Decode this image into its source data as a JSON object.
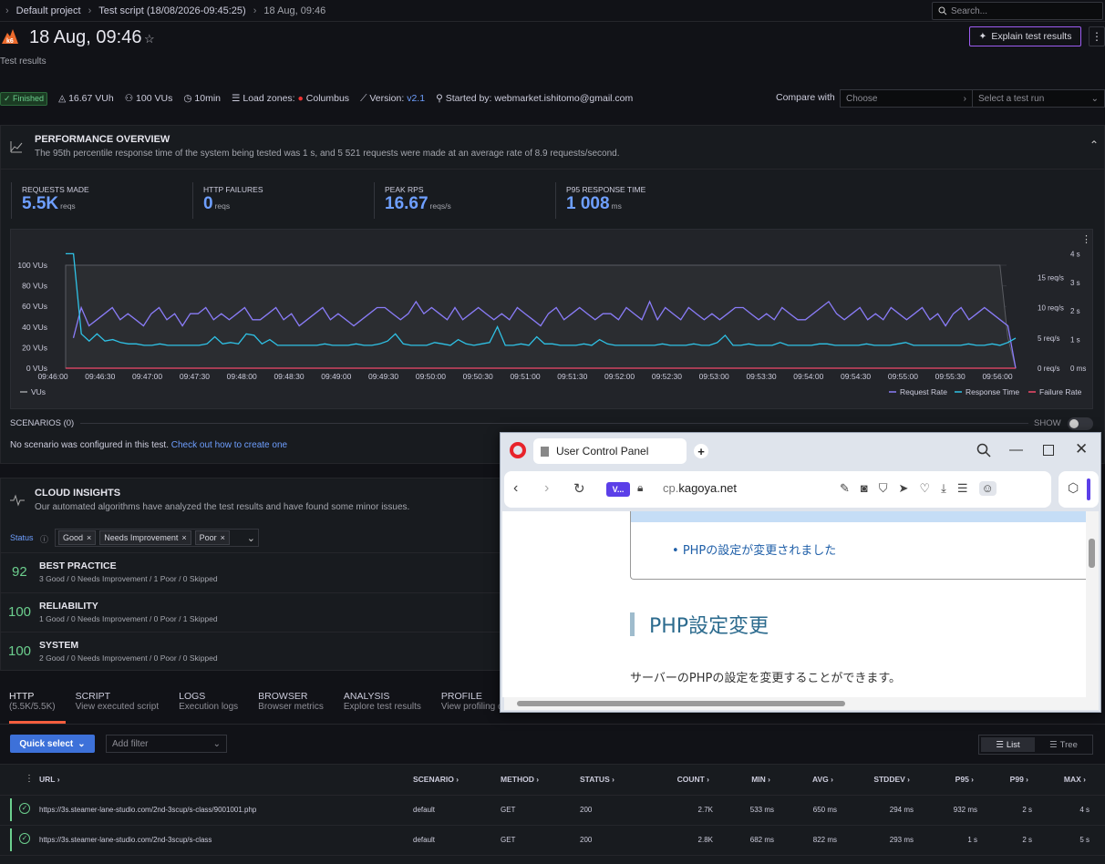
{
  "breadcrumb": {
    "project": "Default project",
    "script": "Test script (18/08/2026-09:45:25)",
    "run": "18 Aug, 09:46"
  },
  "search": {
    "placeholder": "Search..."
  },
  "header": {
    "title": "18 Aug, 09:46",
    "subtitle": "Test results",
    "explain": "Explain test results"
  },
  "meta": {
    "status": "Finished",
    "vuh": "16.67 VUh",
    "vus": "100 VUs",
    "duration": "10min",
    "load_zones_label": "Load zones:",
    "load_zone": "Columbus",
    "version_label": "Version:",
    "version": "v2.1",
    "started_by": "Started by: webmarket.ishitomo@gmail.com"
  },
  "compare": {
    "label": "Compare with",
    "choose": "Choose",
    "select": "Select a test run"
  },
  "overview": {
    "title": "PERFORMANCE OVERVIEW",
    "desc": "The 95th percentile response time of the system being tested was 1 s, and 5 521 requests were made at an average rate of 8.9 requests/second.",
    "stats": [
      {
        "label": "REQUESTS MADE",
        "value": "5.5K",
        "unit": "reqs"
      },
      {
        "label": "HTTP FAILURES",
        "value": "0",
        "unit": "reqs"
      },
      {
        "label": "PEAK RPS",
        "value": "16.67",
        "unit": "reqs/s"
      },
      {
        "label": "P95 RESPONSE TIME",
        "value": "1 008",
        "unit": "ms"
      }
    ]
  },
  "chart_data": {
    "type": "line",
    "x": [
      "09:46:00",
      "09:46:30",
      "09:47:00",
      "09:47:30",
      "09:48:00",
      "09:48:30",
      "09:49:00",
      "09:49:30",
      "09:50:00",
      "09:50:30",
      "09:51:00",
      "09:51:30",
      "09:52:00",
      "09:52:30",
      "09:53:00",
      "09:53:30",
      "09:54:00",
      "09:54:30",
      "09:55:00",
      "09:55:30",
      "09:56:00"
    ],
    "y_left_ticks": [
      "0 VUs",
      "20 VUs",
      "40 VUs",
      "60 VUs",
      "80 VUs",
      "100 VUs"
    ],
    "y_rps_ticks": [
      "0 req/s",
      "5 req/s",
      "10 req/s",
      "15 req/s"
    ],
    "y_time_ticks": [
      "0 ms",
      "1 s",
      "2 s",
      "3 s",
      "4 s"
    ],
    "series": [
      {
        "name": "VUs",
        "color": "#9d9ea3",
        "values": [
          100,
          100,
          100,
          100,
          100,
          100,
          100,
          100,
          100,
          100,
          100,
          100,
          100,
          100,
          100,
          100,
          100,
          100,
          100,
          100,
          100,
          100,
          100,
          100,
          100,
          100,
          100,
          100,
          100,
          100,
          100,
          100,
          100,
          100,
          100,
          100,
          100,
          100,
          100,
          100,
          100,
          100,
          100,
          100,
          100,
          100,
          100,
          100,
          100,
          100,
          100,
          100,
          100,
          100,
          100,
          100,
          100,
          100,
          100,
          100,
          100,
          100,
          100,
          100,
          100,
          100,
          100,
          100,
          100,
          100,
          100,
          100,
          100,
          100,
          100,
          100,
          100,
          100,
          100,
          100,
          100,
          100,
          100,
          100,
          100,
          100,
          100,
          100,
          100,
          100,
          100,
          100,
          100,
          100,
          100,
          100,
          100,
          100,
          100,
          100,
          100,
          100,
          100,
          100,
          100,
          100,
          100,
          100,
          100,
          100,
          100,
          100,
          100,
          100,
          100,
          100,
          100,
          100,
          100,
          100,
          30,
          0
        ]
      },
      {
        "name": "Request Rate",
        "color": "#8a7cf8",
        "values": [
          null,
          5,
          10,
          7,
          8,
          9,
          10,
          8,
          9,
          8,
          7,
          9,
          10,
          8,
          9,
          7,
          9,
          9,
          10,
          8,
          9,
          8,
          9,
          10,
          8,
          8,
          9,
          10,
          8,
          9,
          7,
          8,
          9,
          10,
          8,
          9,
          8,
          7,
          8,
          9,
          10,
          10,
          9,
          8,
          9,
          11,
          9,
          10,
          9,
          8,
          10,
          8,
          9,
          10,
          9,
          8,
          9,
          8,
          10,
          9,
          8,
          7,
          9,
          10,
          8,
          9,
          10,
          9,
          8,
          9,
          9,
          8,
          10,
          9,
          8,
          11,
          8,
          10,
          9,
          8,
          10,
          9,
          8,
          9,
          8,
          9,
          10,
          10,
          9,
          8,
          9,
          8,
          10,
          9,
          8,
          8,
          9,
          10,
          11,
          9,
          8,
          9,
          10,
          8,
          9,
          8,
          10,
          9,
          8,
          9,
          10,
          8,
          9,
          7,
          9,
          10,
          8,
          9,
          10,
          9,
          8,
          7,
          0
        ]
      },
      {
        "name": "Response Time",
        "color": "#2fc2e6",
        "values": [
          4,
          4,
          1.2,
          0.95,
          1.2,
          0.95,
          1,
          0.9,
          0.85,
          0.85,
          0.8,
          0.8,
          0.85,
          0.8,
          0.8,
          0.8,
          0.8,
          0.8,
          0.85,
          1.1,
          0.85,
          0.9,
          0.85,
          1.2,
          1.15,
          0.85,
          1,
          0.8,
          0.8,
          0.8,
          0.8,
          0.8,
          0.8,
          0.85,
          0.8,
          0.8,
          0.8,
          0.85,
          0.8,
          0.8,
          0.85,
          0.95,
          1.2,
          0.85,
          0.8,
          0.8,
          0.8,
          0.9,
          0.85,
          0.8,
          1,
          0.85,
          0.8,
          0.85,
          0.9,
          1.45,
          0.8,
          0.8,
          0.85,
          0.8,
          1.1,
          0.85,
          0.85,
          0.8,
          0.8,
          0.8,
          0.85,
          0.8,
          1,
          0.85,
          0.8,
          0.8,
          0.8,
          0.8,
          0.8,
          0.8,
          0.85,
          0.8,
          0.8,
          0.8,
          0.85,
          0.8,
          0.8,
          0.9,
          1.15,
          0.8,
          0.8,
          0.85,
          0.8,
          0.8,
          0.8,
          0.9,
          0.8,
          0.8,
          0.8,
          0.8,
          0.85,
          0.85,
          0.8,
          0.8,
          0.8,
          0.8,
          0.85,
          0.8,
          0.8,
          0.8,
          0.85,
          0.9,
          0.8,
          0.8,
          0.8,
          0.8,
          0.8,
          0.8,
          0.8,
          0.85,
          0.8,
          0.8,
          0.85,
          0.8,
          0.9,
          1.05
        ]
      },
      {
        "name": "Failure Rate",
        "color": "#f2496b",
        "values": [
          0,
          0
        ]
      }
    ],
    "legend": "bottom-right",
    "grid": true
  },
  "legend": {
    "vus": "VUs",
    "rr": "Request Rate",
    "rt": "Response Time",
    "fr": "Failure Rate"
  },
  "scenarios": {
    "title": "SCENARIOS (0)",
    "show": "SHOW",
    "msg": "No scenario was configured in this test.",
    "link": "Check out how to create one"
  },
  "insights": {
    "title": "CLOUD INSIGHTS",
    "desc": "Our automated algorithms have analyzed the test results and have found some minor issues.",
    "status_label": "Status",
    "chips": [
      "Good",
      "Needs Improvement",
      "Poor"
    ],
    "rows": [
      {
        "score": "92",
        "name": "BEST PRACTICE",
        "sub": "3 Good / 0 Needs Improvement / 1 Poor / 0 Skipped"
      },
      {
        "score": "100",
        "name": "RELIABILITY",
        "sub": "1 Good / 0 Needs Improvement / 0 Poor / 1 Skipped"
      },
      {
        "score": "100",
        "name": "SYSTEM",
        "sub": "2 Good / 0 Needs Improvement / 0 Poor / 0 Skipped"
      }
    ]
  },
  "tabs": [
    {
      "label": "HTTP",
      "sub": "(5.5K/5.5K)"
    },
    {
      "label": "SCRIPT",
      "sub": "View executed script"
    },
    {
      "label": "LOGS",
      "sub": "Execution logs"
    },
    {
      "label": "BROWSER",
      "sub": "Browser metrics"
    },
    {
      "label": "ANALYSIS",
      "sub": "Explore test results"
    },
    {
      "label": "PROFILE",
      "sub": "View profiling data"
    }
  ],
  "toolbar": {
    "quick": "Quick select",
    "filter": "Add filter",
    "list": "List",
    "tree": "Tree"
  },
  "table": {
    "headers": [
      "URL",
      "SCENARIO",
      "METHOD",
      "STATUS",
      "COUNT",
      "MIN",
      "AVG",
      "STDDEV",
      "P95",
      "P99",
      "MAX"
    ],
    "rows": [
      [
        "https://3s.steamer-lane-studio.com/2nd-3scup/s-class/9001001.php",
        "default",
        "GET",
        "200",
        "2.7K",
        "533 ms",
        "650 ms",
        "294 ms",
        "932 ms",
        "2 s",
        "4 s"
      ],
      [
        "https://3s.steamer-lane-studio.com/2nd-3scup/s-class",
        "default",
        "GET",
        "200",
        "2.8K",
        "682 ms",
        "822 ms",
        "293 ms",
        "1 s",
        "2 s",
        "5 s"
      ]
    ]
  },
  "browser": {
    "tab_title": "User Control Panel",
    "vbadge": "V...",
    "url_prefix": "cp.",
    "url_domain": "kagoya.net",
    "bullet": "PHPの設定が変更されました",
    "heading": "PHP設定変更",
    "para": "サーバーのPHPの設定を変更することができます。"
  }
}
